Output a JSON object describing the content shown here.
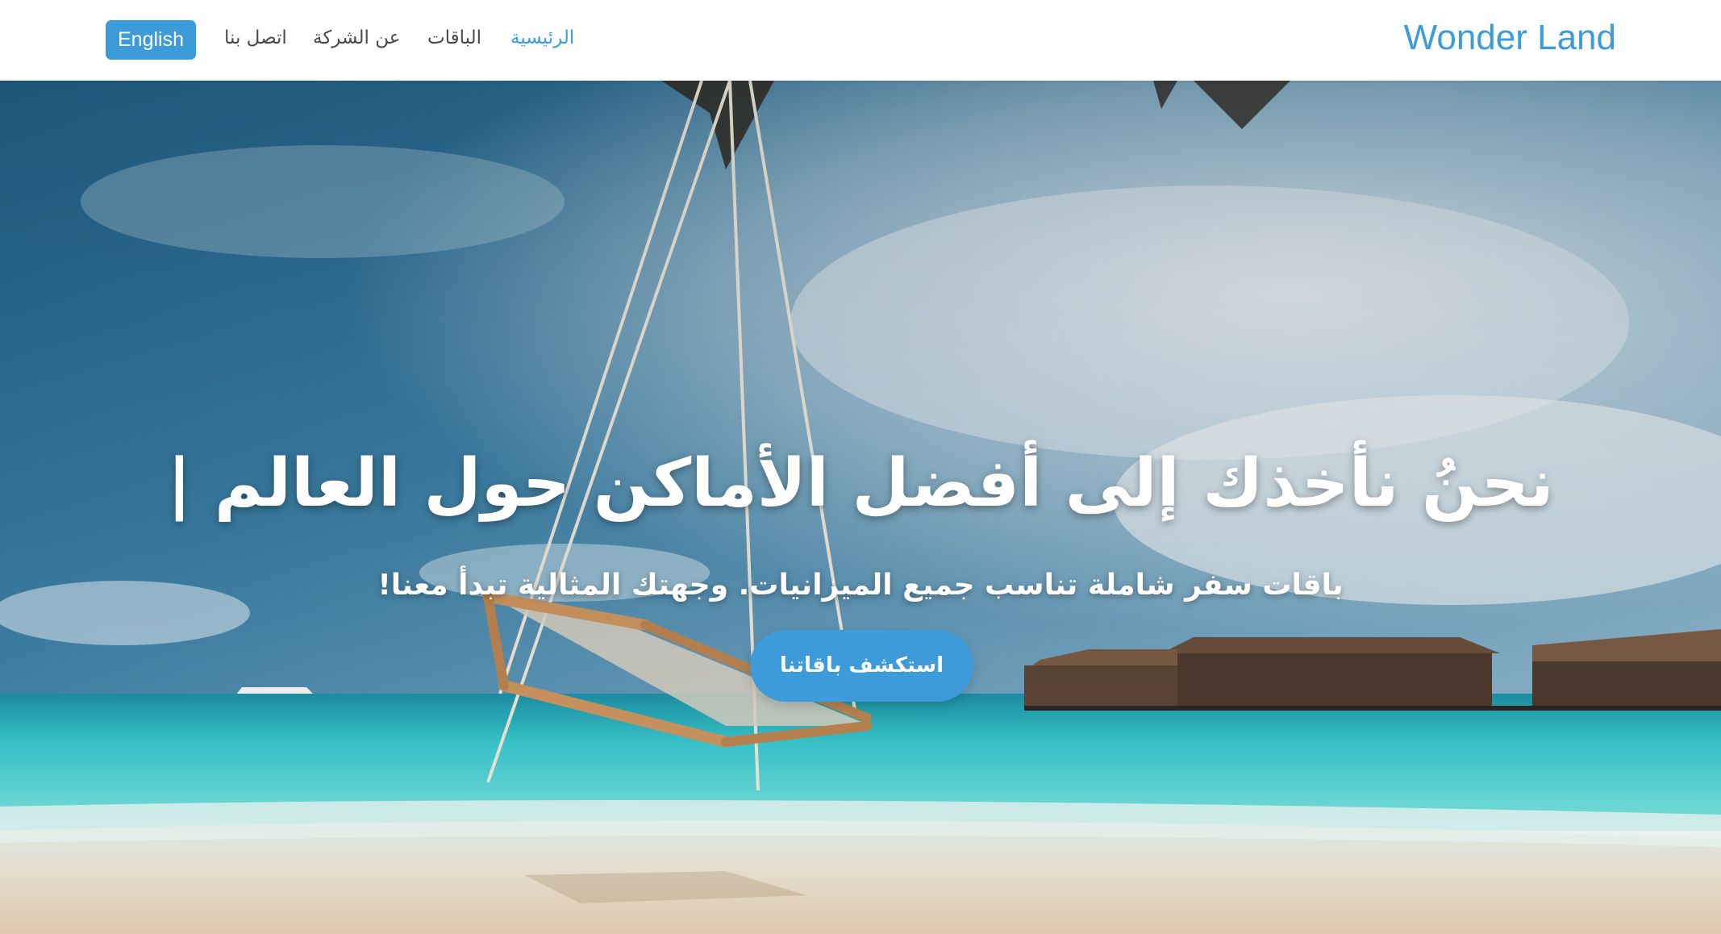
{
  "navbar": {
    "brand": "Wonder Land",
    "links": {
      "home": "الرئيسية",
      "packages": "الباقات",
      "about": "عن الشركة",
      "contact": "اتصل بنا"
    },
    "language_button": "English"
  },
  "hero": {
    "title": "نحنُ نأخذك إلى أفضل الأماكن حول العالم |",
    "subtitle": "باقات سفر شاملة تناسب جميع الميزانيات. وجهتك المثالية تبدأ معنا!",
    "cta_label": "استكشف باقاتنا",
    "background": "beach-swing-photo"
  },
  "colors": {
    "accent": "#3d9bd9",
    "navbar_bg": "#ffffff",
    "nav_text": "#4a4a4a",
    "hero_text": "#ffffff"
  }
}
